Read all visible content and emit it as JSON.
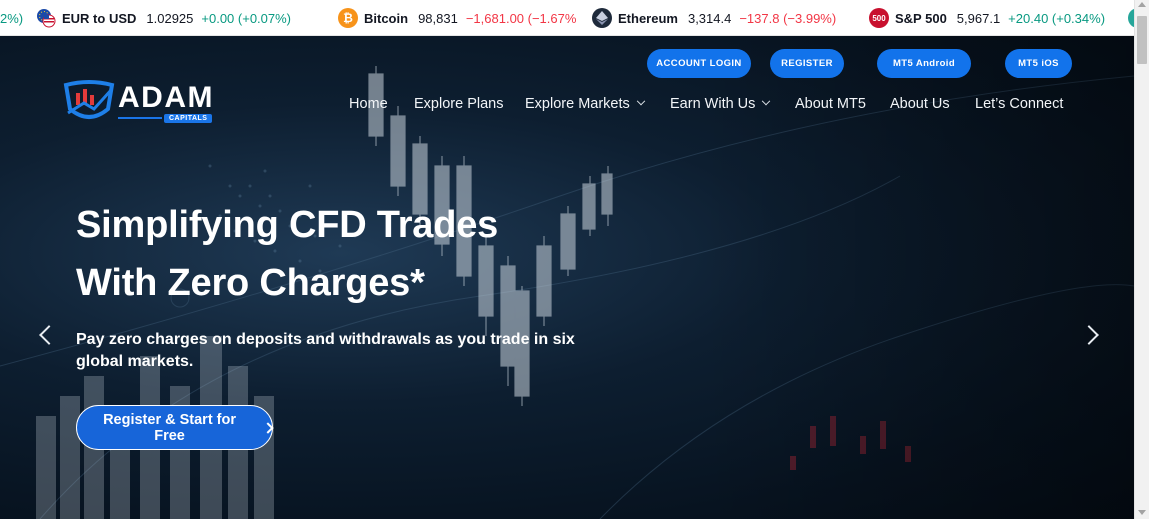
{
  "ticker": [
    {
      "prefix_change": "2%)"
    },
    {
      "symbol": "EUR to USD",
      "price": "1.02925",
      "change": "+0.00 (+0.07%)",
      "direction": "up",
      "icon": "euro-dollar-icon"
    },
    {
      "symbol": "Bitcoin",
      "price": "98,831",
      "change": "−1,681.00 (−1.67%",
      "direction": "down",
      "icon": "bitcoin-icon",
      "icon_glyph": "₿",
      "color": "#f7931a"
    },
    {
      "symbol": "Ethereum",
      "price": "3,314.4",
      "change": "−137.8 (−3.99%)",
      "direction": "down",
      "icon": "ethereum-icon",
      "color": "#1e2a3b"
    },
    {
      "symbol": "S&P 500",
      "price": "5,967.1",
      "change": "+20.40 (+0.34%)",
      "direction": "up",
      "icon": "sp500-icon",
      "icon_glyph": "500",
      "color": "#c8102e"
    }
  ],
  "header": {
    "buttons": [
      "ACCOUNT LOGIN",
      "REGISTER",
      "MT5 Android",
      "MT5 iOS"
    ],
    "logo": {
      "name": "ADAM",
      "sub": "CAPITALS"
    }
  },
  "nav": [
    {
      "label": "Home"
    },
    {
      "label": "Explore Plans"
    },
    {
      "label": "Explore Markets",
      "dropdown": true
    },
    {
      "label": "Earn With Us",
      "dropdown": true
    },
    {
      "label": "About MT5"
    },
    {
      "label": "About Us"
    },
    {
      "label": "Let’s Connect"
    }
  ],
  "hero": {
    "headline_line1": "Simplifying CFD Trades",
    "headline_line2": "With Zero Charges*",
    "subline": "Pay zero charges on deposits and withdrawals as you trade in six global markets.",
    "cta": "Register & Start for Free"
  },
  "colors": {
    "accent": "#1273eb",
    "up": "#089981",
    "down": "#f23645",
    "hero_bg": "#0a1828"
  }
}
